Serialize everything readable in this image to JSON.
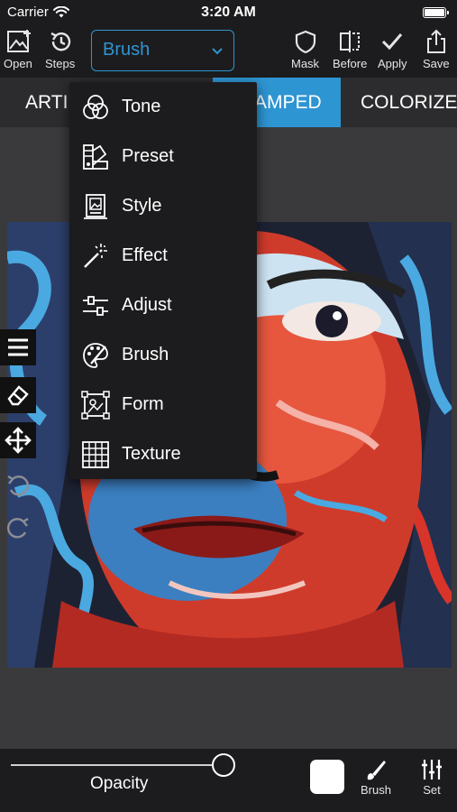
{
  "status": {
    "carrier": "Carrier",
    "time": "3:20 AM"
  },
  "toolbar": {
    "open_label": "Open",
    "steps_label": "Steps",
    "mode_value": "Brush",
    "mask_label": "Mask",
    "before_label": "Before",
    "apply_label": "Apply",
    "save_label": "Save"
  },
  "tabs": [
    {
      "label": "ARTI"
    },
    {
      "label": "AMPED",
      "active": true
    },
    {
      "label": "COLORIZE"
    }
  ],
  "menu": {
    "items": [
      {
        "label": "Tone",
        "icon": "tone-icon"
      },
      {
        "label": "Preset",
        "icon": "preset-icon"
      },
      {
        "label": "Style",
        "icon": "style-icon"
      },
      {
        "label": "Effect",
        "icon": "effect-icon"
      },
      {
        "label": "Adjust",
        "icon": "adjust-icon"
      },
      {
        "label": "Brush",
        "icon": "brush-icon"
      },
      {
        "label": "Form",
        "icon": "form-icon"
      },
      {
        "label": "Texture",
        "icon": "texture-icon"
      }
    ]
  },
  "bottom": {
    "opacity_label": "Opacity",
    "opacity_value": 1.0,
    "brush_label": "Brush",
    "set_label": "Set",
    "swatch_color": "#ffffff"
  },
  "colors": {
    "accent": "#2e95d3",
    "bar": "#1c1c1e",
    "canvas_bg": "#3a3a3c"
  }
}
